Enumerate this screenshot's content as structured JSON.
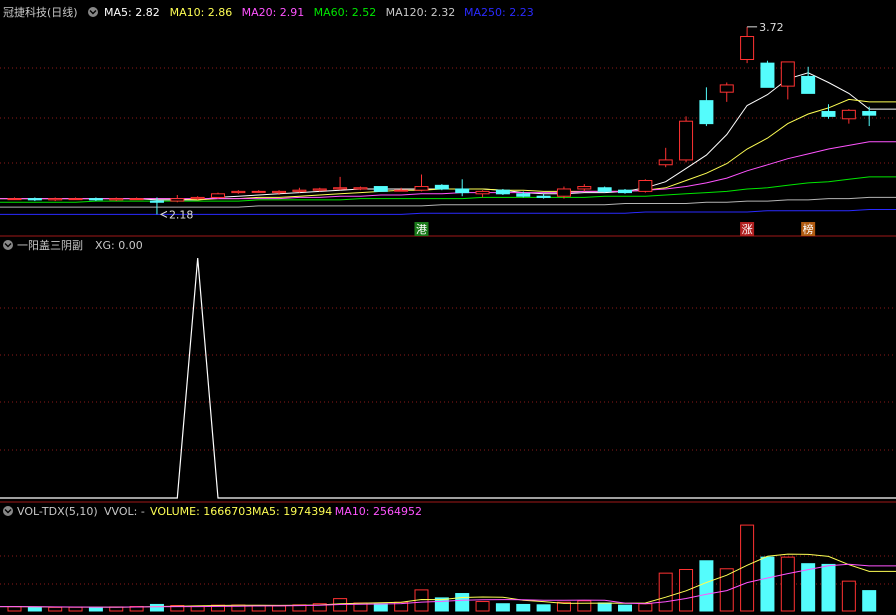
{
  "colors": {
    "background": "#000000",
    "up": "#ff3232",
    "down": "#54fcfc",
    "grid": "#8b1a1a",
    "ma5": "#ffffff",
    "ma10": "#ffff54",
    "ma20": "#ff54ff",
    "ma60": "#00e600",
    "ma120": "#b4b4b4",
    "ma250": "#2a2aff",
    "xg": "#ffffff",
    "vol_ma5": "#ffff54",
    "vol_ma10": "#ff54ff",
    "header_text": "#c8c8c8"
  },
  "icons": {
    "panel_toggle": "chevron-down-circle-icon"
  },
  "price_panel": {
    "title": "冠捷科技(日线)",
    "legend": [
      {
        "label": "MA5: 2.82",
        "color": "#ffffff"
      },
      {
        "label": "MA10: 2.86",
        "color": "#ffff54"
      },
      {
        "label": "MA20: 2.91",
        "color": "#ff54ff"
      },
      {
        "label": "MA60: 2.52",
        "color": "#00e600"
      },
      {
        "label": "MA120: 2.32",
        "color": "#c8c8c8"
      },
      {
        "label": "MA250: 2.23",
        "color": "#2a2aff"
      }
    ],
    "high_label": "3.72",
    "low_label": "2.18",
    "markers": [
      {
        "text": "港",
        "day": 20,
        "bg": "#1a7a1a"
      },
      {
        "text": "涨",
        "day": 36,
        "bg": "#b02020"
      },
      {
        "text": "榜",
        "day": 39,
        "bg": "#b05a10"
      }
    ]
  },
  "indicator_panel": {
    "title": "一阳盖三阴副",
    "value_label": "XG: 0.00"
  },
  "volume_panel": {
    "title": "VOL-TDX(5,10)",
    "vvol_label": "VVOL: -",
    "legend": [
      {
        "label": "VOLUME: 1666703",
        "color": "#ffff54"
      },
      {
        "label": "MA5: 1974394",
        "color": "#ffff54"
      },
      {
        "label": "MA10: 2564952",
        "color": "#ff54ff"
      }
    ]
  },
  "chart_data": [
    {
      "type": "candlestick",
      "title": "冠捷科技(日线)",
      "ohlc": [
        [
          2.3,
          2.31,
          2.29,
          2.3
        ],
        [
          2.3,
          2.31,
          2.28,
          2.29
        ],
        [
          2.29,
          2.31,
          2.28,
          2.3
        ],
        [
          2.3,
          2.31,
          2.29,
          2.3
        ],
        [
          2.3,
          2.31,
          2.28,
          2.29
        ],
        [
          2.29,
          2.31,
          2.28,
          2.3
        ],
        [
          2.3,
          2.31,
          2.29,
          2.3
        ],
        [
          2.28,
          2.31,
          2.17,
          2.27
        ],
        [
          2.28,
          2.33,
          2.27,
          2.3
        ],
        [
          2.3,
          2.32,
          2.29,
          2.31
        ],
        [
          2.31,
          2.35,
          2.3,
          2.34
        ],
        [
          2.35,
          2.37,
          2.34,
          2.36
        ],
        [
          2.36,
          2.37,
          2.35,
          2.36
        ],
        [
          2.35,
          2.37,
          2.33,
          2.36
        ],
        [
          2.36,
          2.39,
          2.35,
          2.37
        ],
        [
          2.37,
          2.39,
          2.36,
          2.38
        ],
        [
          2.38,
          2.48,
          2.37,
          2.39
        ],
        [
          2.38,
          2.4,
          2.37,
          2.39
        ],
        [
          2.4,
          2.38,
          2.36,
          2.36
        ],
        [
          2.37,
          2.39,
          2.36,
          2.37
        ],
        [
          2.37,
          2.5,
          2.36,
          2.4
        ],
        [
          2.41,
          2.42,
          2.37,
          2.38
        ],
        [
          2.38,
          2.46,
          2.32,
          2.35
        ],
        [
          2.34,
          2.37,
          2.31,
          2.36
        ],
        [
          2.37,
          2.38,
          2.33,
          2.34
        ],
        [
          2.34,
          2.36,
          2.31,
          2.32
        ],
        [
          2.32,
          2.34,
          2.3,
          2.31
        ],
        [
          2.32,
          2.4,
          2.3,
          2.38
        ],
        [
          2.38,
          2.42,
          2.36,
          2.4
        ],
        [
          2.39,
          2.4,
          2.35,
          2.36
        ],
        [
          2.37,
          2.38,
          2.34,
          2.35
        ],
        [
          2.36,
          2.46,
          2.35,
          2.45
        ],
        [
          2.58,
          2.72,
          2.56,
          2.62
        ],
        [
          2.62,
          2.98,
          2.6,
          2.94
        ],
        [
          3.11,
          3.22,
          2.9,
          2.92
        ],
        [
          3.18,
          3.26,
          3.1,
          3.24
        ],
        [
          3.45,
          3.72,
          3.42,
          3.64
        ],
        [
          3.42,
          3.44,
          3.22,
          3.22
        ],
        [
          3.23,
          3.42,
          3.12,
          3.43
        ],
        [
          3.31,
          3.39,
          3.17,
          3.17
        ],
        [
          3.02,
          3.08,
          2.96,
          2.98
        ],
        [
          2.96,
          3.04,
          2.92,
          3.03
        ],
        [
          3.02,
          3.06,
          2.9,
          2.99
        ]
      ],
      "series": [
        {
          "name": "MA5",
          "values": [
            2.3,
            2.3,
            2.3,
            2.3,
            2.3,
            2.3,
            2.3,
            2.29,
            2.29,
            2.29,
            2.31,
            2.32,
            2.33,
            2.34,
            2.35,
            2.36,
            2.37,
            2.38,
            2.38,
            2.38,
            2.38,
            2.38,
            2.38,
            2.38,
            2.37,
            2.35,
            2.34,
            2.34,
            2.35,
            2.35,
            2.36,
            2.39,
            2.44,
            2.55,
            2.66,
            2.83,
            3.07,
            3.16,
            3.29,
            3.34,
            3.26,
            3.17,
            3.04
          ]
        },
        {
          "name": "MA10",
          "values": [
            2.3,
            2.3,
            2.3,
            2.3,
            2.3,
            2.3,
            2.3,
            2.3,
            2.3,
            2.29,
            2.3,
            2.3,
            2.31,
            2.31,
            2.32,
            2.33,
            2.34,
            2.35,
            2.36,
            2.37,
            2.37,
            2.38,
            2.38,
            2.38,
            2.37,
            2.37,
            2.36,
            2.36,
            2.36,
            2.36,
            2.36,
            2.37,
            2.39,
            2.45,
            2.51,
            2.59,
            2.71,
            2.8,
            2.92,
            3.0,
            3.05,
            3.12,
            3.1
          ]
        },
        {
          "name": "MA20",
          "values": [
            2.3,
            2.3,
            2.3,
            2.3,
            2.3,
            2.3,
            2.3,
            2.3,
            2.3,
            2.3,
            2.3,
            2.3,
            2.3,
            2.3,
            2.31,
            2.31,
            2.32,
            2.32,
            2.33,
            2.33,
            2.34,
            2.34,
            2.35,
            2.35,
            2.35,
            2.35,
            2.35,
            2.35,
            2.36,
            2.36,
            2.36,
            2.37,
            2.38,
            2.4,
            2.43,
            2.47,
            2.53,
            2.58,
            2.63,
            2.67,
            2.71,
            2.74,
            2.77
          ]
        },
        {
          "name": "MA60",
          "values": [
            2.27,
            2.27,
            2.27,
            2.27,
            2.28,
            2.28,
            2.28,
            2.28,
            2.28,
            2.28,
            2.28,
            2.28,
            2.29,
            2.29,
            2.29,
            2.29,
            2.29,
            2.3,
            2.3,
            2.3,
            2.3,
            2.3,
            2.3,
            2.31,
            2.31,
            2.31,
            2.31,
            2.31,
            2.31,
            2.32,
            2.32,
            2.32,
            2.33,
            2.34,
            2.35,
            2.36,
            2.38,
            2.39,
            2.41,
            2.43,
            2.44,
            2.46,
            2.48
          ]
        },
        {
          "name": "MA120",
          "values": [
            2.23,
            2.23,
            2.23,
            2.23,
            2.23,
            2.23,
            2.23,
            2.23,
            2.23,
            2.23,
            2.23,
            2.23,
            2.24,
            2.24,
            2.24,
            2.24,
            2.24,
            2.24,
            2.24,
            2.24,
            2.24,
            2.25,
            2.25,
            2.25,
            2.25,
            2.25,
            2.25,
            2.25,
            2.25,
            2.25,
            2.26,
            2.26,
            2.26,
            2.26,
            2.27,
            2.27,
            2.28,
            2.28,
            2.29,
            2.29,
            2.3,
            2.3,
            2.31
          ]
        },
        {
          "name": "MA250",
          "values": [
            2.17,
            2.17,
            2.17,
            2.17,
            2.17,
            2.17,
            2.17,
            2.17,
            2.17,
            2.17,
            2.17,
            2.17,
            2.17,
            2.17,
            2.17,
            2.17,
            2.17,
            2.17,
            2.17,
            2.17,
            2.18,
            2.18,
            2.18,
            2.18,
            2.18,
            2.18,
            2.18,
            2.18,
            2.18,
            2.18,
            2.18,
            2.19,
            2.19,
            2.19,
            2.19,
            2.19,
            2.19,
            2.2,
            2.2,
            2.2,
            2.2,
            2.2,
            2.21
          ]
        }
      ],
      "ylim": [
        2.14,
        3.76
      ]
    },
    {
      "type": "line",
      "title": "一阳盖三阴副",
      "series": [
        {
          "name": "XG",
          "values": [
            0,
            0,
            0,
            0,
            0,
            0,
            0,
            0,
            0,
            1,
            0,
            0,
            0,
            0,
            0,
            0,
            0,
            0,
            0,
            0,
            0,
            0,
            0,
            0,
            0,
            0,
            0,
            0,
            0,
            0,
            0,
            0,
            0,
            0,
            0,
            0,
            0,
            0,
            0,
            0,
            0,
            0,
            0
          ]
        }
      ],
      "ylim": [
        0,
        1
      ]
    },
    {
      "type": "bar",
      "title": "VOL-TDX(5,10)",
      "values": [
        600000,
        550000,
        500000,
        520000,
        480000,
        560000,
        620000,
        900000,
        750000,
        700000,
        800000,
        820000,
        760000,
        700000,
        840000,
        1000000,
        1700000,
        1100000,
        1000000,
        1200000,
        2900000,
        1800000,
        2400000,
        1300000,
        1000000,
        900000,
        850000,
        1200000,
        1400000,
        1100000,
        800000,
        1000000,
        5200000,
        5700000,
        6900000,
        5800000,
        11800000,
        7400000,
        7400000,
        6500000,
        6400000,
        4100000,
        2800000
      ],
      "series": [
        {
          "name": "MA5",
          "values": [
            600000,
            575000,
            550000,
            542500,
            530000,
            522000,
            546000,
            616000,
            662000,
            706000,
            754000,
            798000,
            794000,
            766000,
            784000,
            824000,
            1000000,
            1068000,
            1128000,
            1200000,
            1580000,
            1560000,
            1860000,
            1920000,
            1880000,
            1480000,
            1290000,
            1050000,
            1070000,
            1090000,
            1070000,
            1100000,
            1900000,
            2780000,
            3920000,
            4920000,
            6280000,
            7520000,
            7820000,
            7780000,
            7500000,
            6360000,
            5440000
          ]
        },
        {
          "name": "MA10",
          "values": [
            600000,
            575000,
            556667,
            547500,
            534000,
            538333,
            550000,
            582500,
            601111,
            611000,
            631000,
            658000,
            684000,
            701000,
            737000,
            781000,
            889000,
            937000,
            967000,
            1017000,
            1227000,
            1325000,
            1489000,
            1549000,
            1565000,
            1555000,
            1470000,
            1480000,
            1500000,
            1490000,
            1080000,
            1000000,
            1280000,
            1720000,
            2310000,
            2800000,
            3900000,
            4530000,
            5140000,
            5680000,
            6220000,
            6430000,
            6190000
          ]
        }
      ]
    }
  ]
}
